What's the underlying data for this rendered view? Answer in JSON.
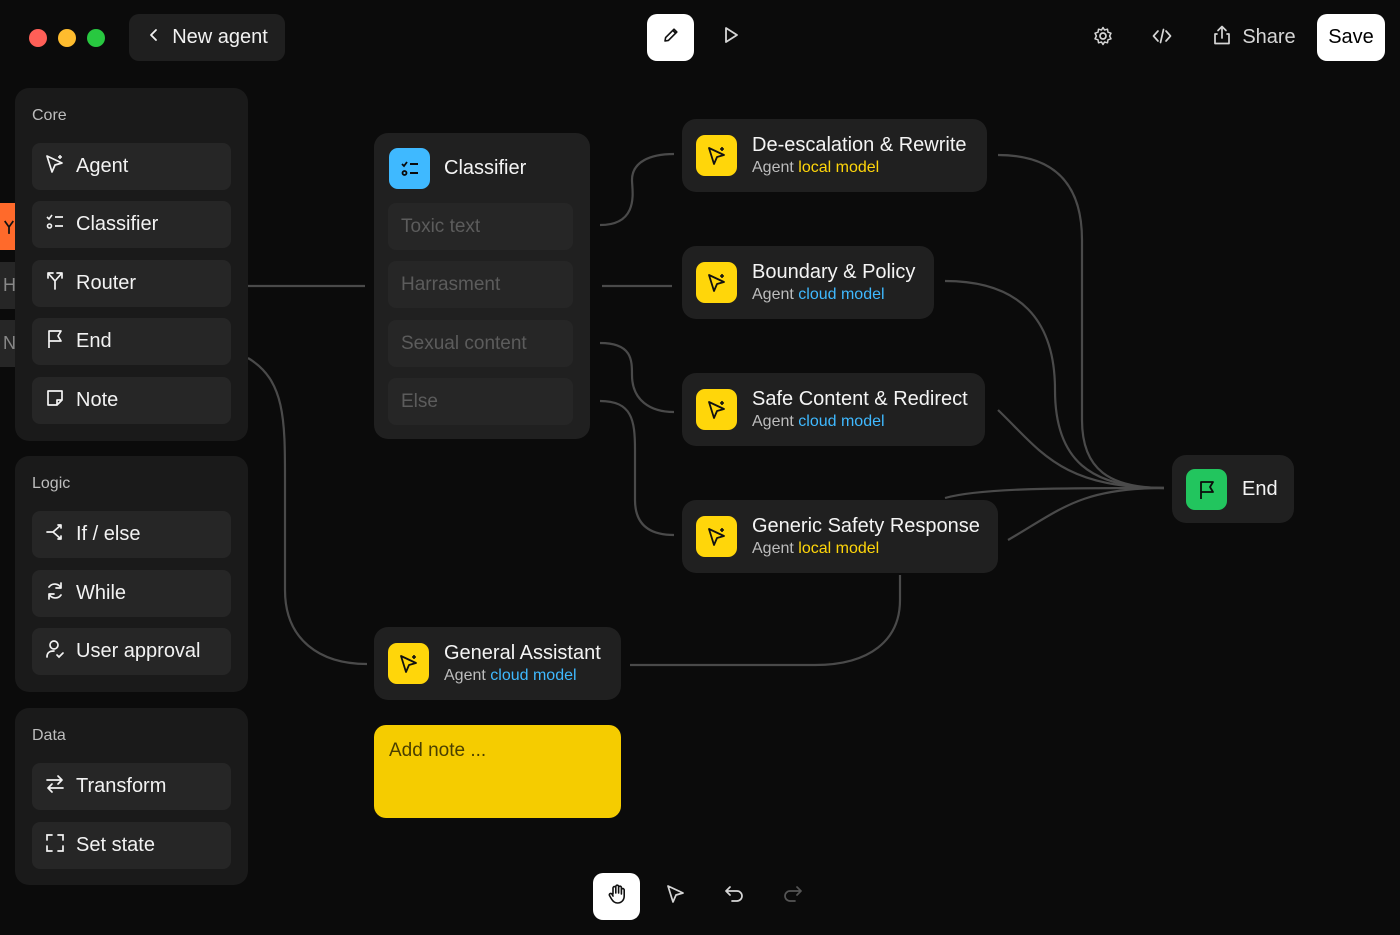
{
  "window": {
    "controls": [
      {
        "name": "close",
        "color": "#ff5f57"
      },
      {
        "name": "minimize",
        "color": "#febc2e"
      },
      {
        "name": "maximize",
        "color": "#28c840"
      }
    ]
  },
  "header": {
    "back_label": "New agent",
    "share_label": "Share",
    "save_label": "Save",
    "icons": [
      "pencil-icon",
      "play-icon",
      "gear-icon",
      "code-icon",
      "share-icon"
    ]
  },
  "sidebar": {
    "sections": [
      {
        "title": "Core",
        "items": [
          {
            "label": "Agent",
            "icon": "agent-icon"
          },
          {
            "label": "Classifier",
            "icon": "classifier-icon"
          },
          {
            "label": "Router",
            "icon": "router-icon"
          },
          {
            "label": "End",
            "icon": "flag-icon"
          },
          {
            "label": "Note",
            "icon": "note-icon"
          }
        ]
      },
      {
        "title": "Logic",
        "items": [
          {
            "label": "If / else",
            "icon": "branch-icon"
          },
          {
            "label": "While",
            "icon": "loop-icon"
          },
          {
            "label": "User approval",
            "icon": "user-approval-icon"
          }
        ]
      },
      {
        "title": "Data",
        "items": [
          {
            "label": "Transform",
            "icon": "transform-icon"
          },
          {
            "label": "Set state",
            "icon": "set-state-icon"
          }
        ]
      }
    ],
    "behind_strip": [
      "H",
      "N"
    ]
  },
  "canvas": {
    "classifier": {
      "title": "Classifier",
      "rows": [
        "Toxic text",
        "Harrasment",
        "Sexual content",
        "Else"
      ]
    },
    "agents": [
      {
        "title": "De-escalation & Rewrite",
        "kind": "Agent",
        "model": "local model"
      },
      {
        "title": "Boundary & Policy",
        "kind": "Agent",
        "model": "cloud model"
      },
      {
        "title": "Safe Content & Redirect",
        "kind": "Agent",
        "model": "cloud model"
      },
      {
        "title": "Generic Safety Response",
        "kind": "Agent",
        "model": "local model"
      },
      {
        "title": "General Assistant",
        "kind": "Agent",
        "model": "cloud model"
      }
    ],
    "end": {
      "title": "End"
    },
    "note": {
      "placeholder": "Add note ..."
    }
  },
  "toolbar": {
    "tools": [
      {
        "name": "hand-icon",
        "active": true
      },
      {
        "name": "pointer-icon",
        "active": false
      },
      {
        "name": "undo-icon",
        "active": false
      },
      {
        "name": "redo-icon",
        "active": false,
        "disabled": true
      }
    ]
  },
  "colors": {
    "agent_icon_bg": "#ffd60a",
    "classifier_icon_bg": "#3fb9ff",
    "end_icon_bg": "#22c55e",
    "note_bg": "#f5cc00",
    "local_model": "#ffd60a",
    "cloud_model": "#3fb9ff",
    "router_strip": "#ff6a2b"
  }
}
